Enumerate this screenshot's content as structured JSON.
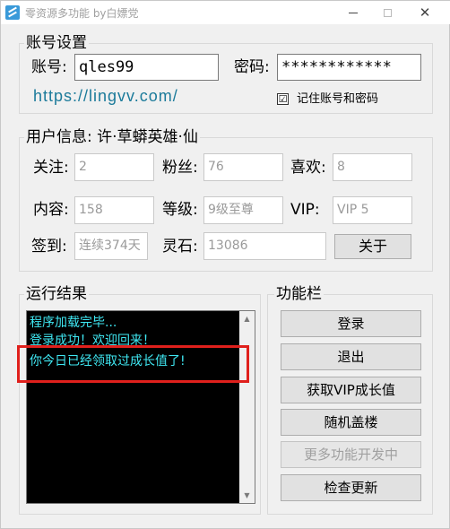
{
  "window": {
    "title": "零资源多功能 by白嫖党",
    "minimize_glyph": "",
    "close_glyph": "✕"
  },
  "account": {
    "group_title": "账号设置",
    "username_label": "账号:",
    "username_value": "qles99",
    "password_label": "密码:",
    "password_value": "************",
    "website": "https://lingvv.com/",
    "remember_checked": "☑",
    "remember_label": "记住账号和密码"
  },
  "user_info": {
    "group_title": "用户信息: 许·草蟒英雄·仙",
    "fields": [
      {
        "label": "关注:",
        "value": "2"
      },
      {
        "label": "粉丝:",
        "value": "76"
      },
      {
        "label": "喜欢:",
        "value": "8"
      },
      {
        "label": "内容:",
        "value": "158"
      },
      {
        "label": "等级:",
        "value": "9级至尊"
      },
      {
        "label": "VIP:",
        "value": "VIP 5"
      },
      {
        "label": "签到:",
        "value": "连续374天"
      },
      {
        "label": "灵石:",
        "value": "13086"
      }
    ],
    "about_button": "关于"
  },
  "results": {
    "group_title": "运行结果",
    "lines": [
      "程序加载完毕...",
      "登录成功！欢迎回来！",
      "你今日已经领取过成长值了!"
    ]
  },
  "functions": {
    "group_title": "功能栏",
    "buttons": [
      {
        "label": "登录",
        "enabled": true
      },
      {
        "label": "退出",
        "enabled": true
      },
      {
        "label": "获取VIP成长值",
        "enabled": true
      },
      {
        "label": "随机盖楼",
        "enabled": true
      },
      {
        "label": "更多功能开发中",
        "enabled": false
      },
      {
        "label": "检查更新",
        "enabled": true
      }
    ]
  },
  "colors": {
    "log_text": "#3fe7f2",
    "link": "#1b7a9a",
    "highlight": "#e0201c"
  }
}
